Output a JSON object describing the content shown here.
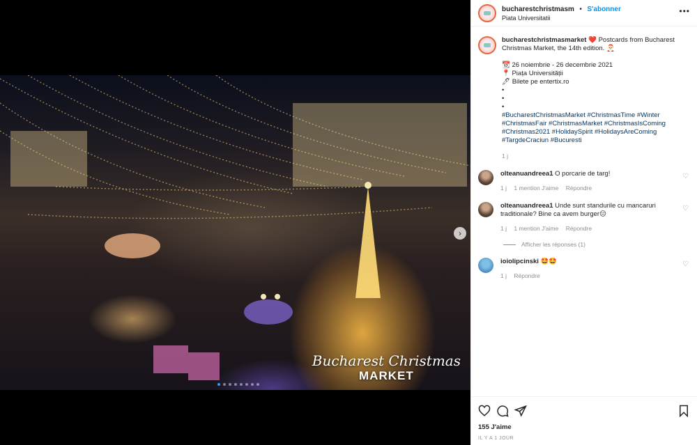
{
  "header": {
    "username": "bucharestchristmasm",
    "separator": "•",
    "follow_label": "S'abonner",
    "location": "Piata Universitatii",
    "more_icon": "more-icon"
  },
  "caption": {
    "username": "bucharestchristmasmarket",
    "heart": "❤️",
    "text": "Postcards from Bucharest Christmas Market, the 14th edition. 🎅",
    "dates": "📆 26 noiembrie - 26 decembrie 2021",
    "place": "📍 Piața Universității",
    "tickets": "🖊 Bilete pe entertix.ro",
    "bullet1": "•",
    "bullet2": "•",
    "bullet3": "•",
    "hashtags": "#BucharestChristmasMarket #ChristmasTime #Winter #ChristmasFair #ChristmasMarket #ChristmasIsComing #Christmas2021 #HolidaySpirit #HolidaysAreComing #TargdeCraciun #Bucuresti",
    "time": "1 j"
  },
  "comments": [
    {
      "username": "olteanuandreea1",
      "text": "O porcarie de targ!",
      "time": "1 j",
      "likes": "1 mention J'aime",
      "reply": "Répondre"
    },
    {
      "username": "olteanuandreea1",
      "text": "Unde sunt standurile cu mancaruri traditionale? Bine ca avem burger😑",
      "time": "1 j",
      "likes": "1 mention J'aime",
      "reply": "Répondre"
    },
    {
      "username": "ioiolipcinski",
      "text": "🤩🤩",
      "time": "1 j",
      "reply": "Répondre"
    }
  ],
  "view_replies": "Afficher les réponses (1)",
  "likes_count": "155 J'aime",
  "posted_ago": "IL Y A 1 JOUR",
  "watermark": {
    "line1": "Bucharest Christmas",
    "line2": "MARKET"
  },
  "carousel": {
    "total": 8,
    "current": 1
  },
  "colors": {
    "follow": "#0095f6",
    "hashtag": "#00376b",
    "meta": "#8e8e8e"
  }
}
